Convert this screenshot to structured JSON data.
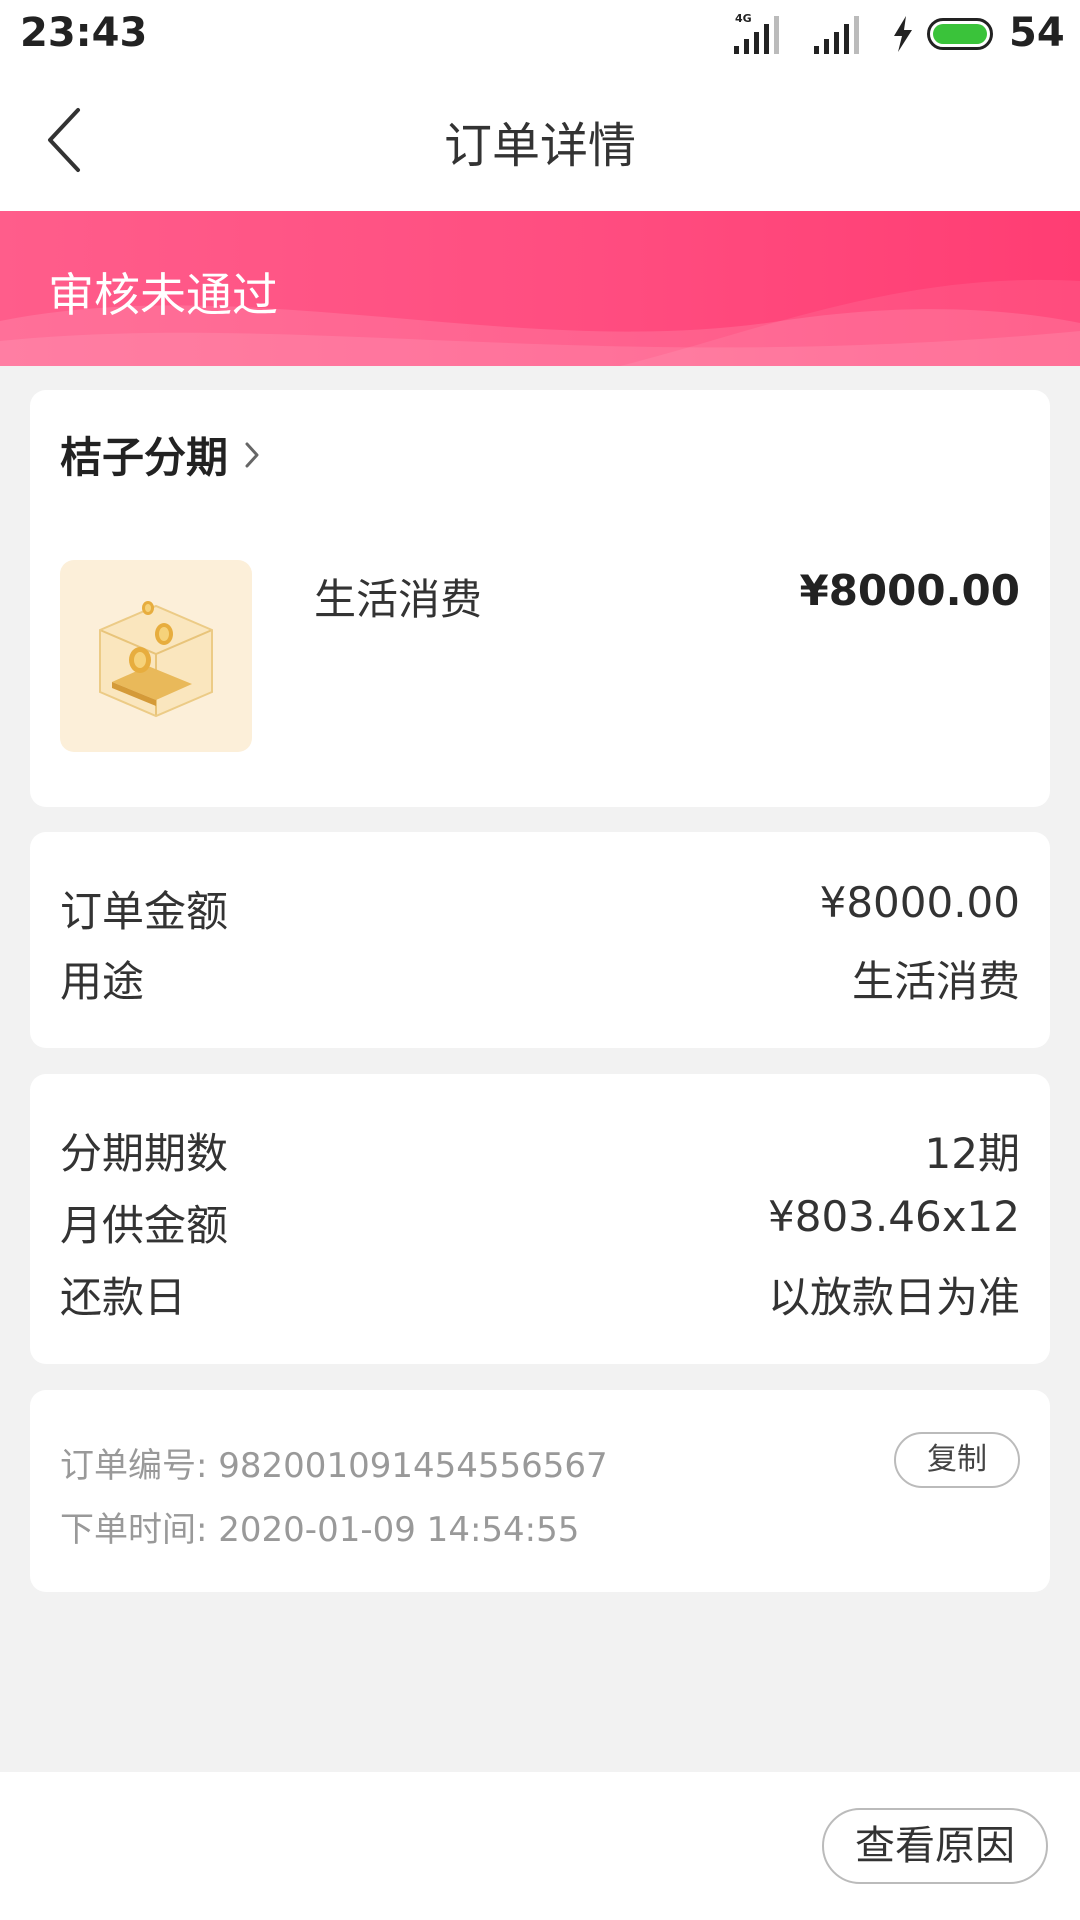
{
  "status_bar": {
    "time": "23:43",
    "network": "4G",
    "battery_level": "54",
    "charging": true,
    "battery_color": "#3ac33a"
  },
  "nav": {
    "title": "订单详情",
    "back_icon": "chevron-left-icon"
  },
  "banner": {
    "status_text": "审核未通过",
    "color": "#ff4d80"
  },
  "merchant": {
    "name": "桔子分期",
    "chevron_icon": "chevron-right-icon",
    "product_icon": "coin-box-icon",
    "product_name": "生活消费",
    "product_price": "¥8000.00"
  },
  "amount_card": {
    "rows": [
      {
        "label": "订单金额",
        "value": "¥8000.00"
      },
      {
        "label": "用途",
        "value": "生活消费"
      }
    ]
  },
  "installment_card": {
    "rows": [
      {
        "label": "分期期数",
        "value": "12期"
      },
      {
        "label": "月供金额",
        "value": "¥803.46x12"
      },
      {
        "label": "还款日",
        "value": "以放款日为准"
      }
    ]
  },
  "order_info": {
    "order_no_label": "订单编号:",
    "order_no": "982001091454556567",
    "order_time_label": "下单时间:",
    "order_time": "2020-01-09 14:54:55",
    "copy_label": "复制"
  },
  "bottom": {
    "reason_button": "查看原因"
  }
}
